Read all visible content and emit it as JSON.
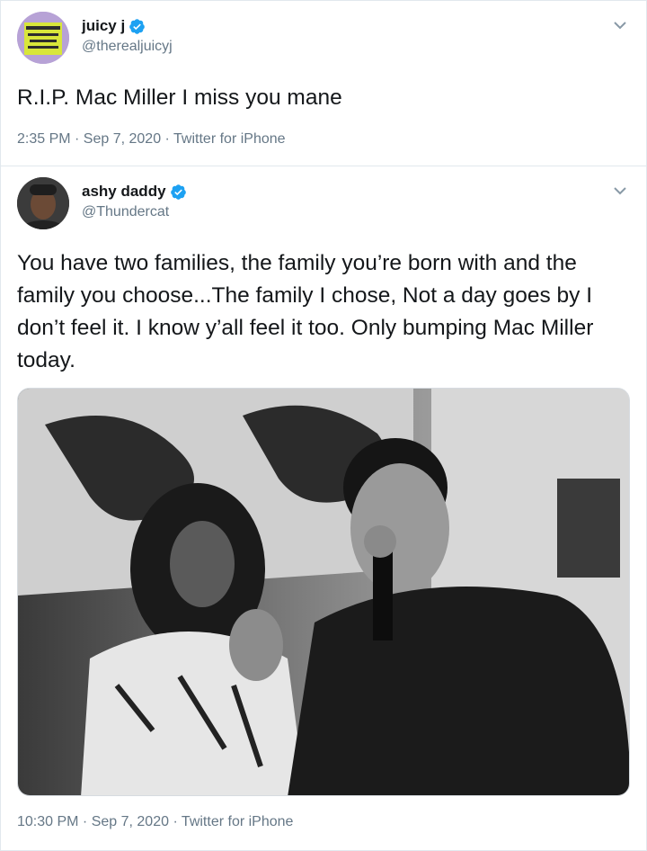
{
  "tweets": [
    {
      "display_name": "juicy j",
      "handle": "@therealjuicyj",
      "text": "R.I.P. Mac Miller I miss you mane",
      "timestamp": "2:35 PM · Sep 7, 2020 · Twitter for iPhone",
      "verified": true,
      "avatar_color": "#b7a2d6"
    },
    {
      "display_name": "ashy daddy",
      "handle": "@Thundercat",
      "text": "You have two families, the family you’re born with and the family you choose...The family I chose, Not a day goes by I don’t feel it. I know y’all feel it too. Only bumping Mac Miller today.",
      "timestamp": "10:30 PM · Sep 7, 2020 · Twitter for iPhone",
      "verified": true,
      "media": "black-and-white photo of two performers on stage with a microphone"
    }
  ],
  "colors": {
    "verified_blue": "#1da1f2",
    "secondary_text": "#657786",
    "primary_text": "#14171a",
    "border": "#e1e8ed"
  },
  "icons": [
    "verified-badge-icon",
    "chevron-down-icon"
  ]
}
